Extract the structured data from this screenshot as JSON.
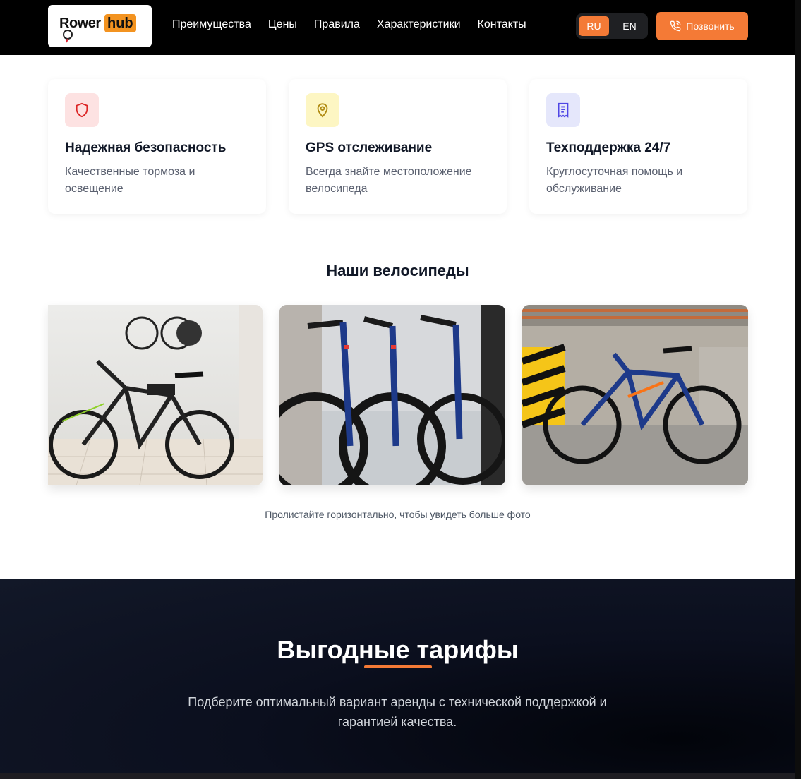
{
  "header": {
    "logo_word1": "Rower",
    "logo_word2": "hub",
    "nav": [
      "Преимущества",
      "Цены",
      "Правила",
      "Характеристики",
      "Контакты"
    ],
    "lang_ru": "RU",
    "lang_en": "EN",
    "call_label": "Позвонить",
    "accent": "#f47a36"
  },
  "features": [
    {
      "icon": "shield-icon",
      "icon_bg": "#fde2e2",
      "icon_color": "#dc2626",
      "title": "Надежная безопасность",
      "text": "Качественные тормоза и освещение"
    },
    {
      "icon": "location-pin-icon",
      "icon_bg": "#fdf6c3",
      "icon_color": "#b08a11",
      "title": "GPS отслеживание",
      "text": "Всегда знайте местоположение велосипеда"
    },
    {
      "icon": "document-icon",
      "icon_bg": "#e5e7fb",
      "icon_color": "#4f46e5",
      "title": "Техподдержка 24/7",
      "text": "Круглосуточная помощь и обслуживание"
    }
  ],
  "bikes": {
    "title": "Наши велосипеды",
    "hint": "Пролистайте горизонтально, чтобы увидеть больше фото"
  },
  "tariffs": {
    "title": "Выгодные тарифы",
    "subtitle": "Подберите оптимальный вариант аренды с технической поддержкой и гарантией качества."
  }
}
